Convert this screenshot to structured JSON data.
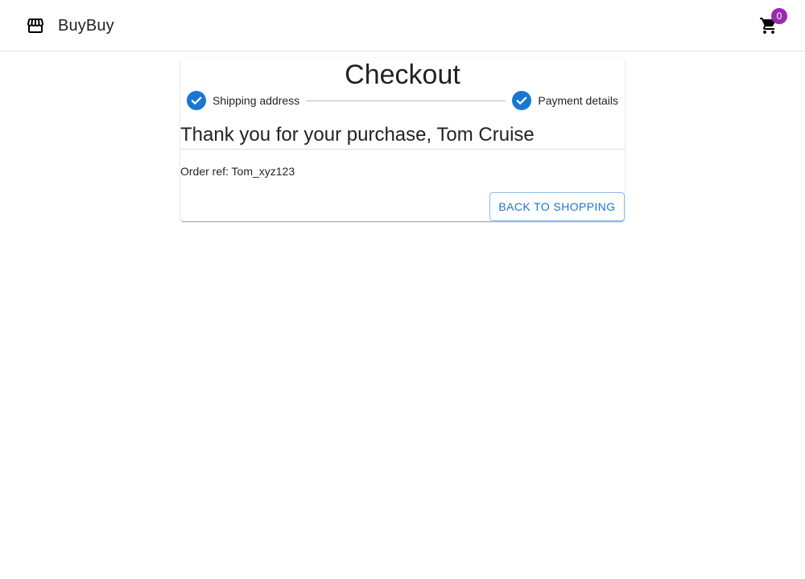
{
  "header": {
    "brand_name": "BuyBuy",
    "brand_icon": "storefront-icon",
    "cart_icon": "shopping-cart-icon",
    "cart_count": "0"
  },
  "checkout": {
    "title": "Checkout",
    "steps": [
      {
        "label": "Shipping address",
        "status": "completed",
        "icon": "check-circle-icon"
      },
      {
        "label": "Payment details",
        "status": "completed",
        "icon": "check-circle-icon"
      }
    ],
    "thank_you": "Thank you for your purchase, Tom Cruise",
    "order_ref": "Order ref: Tom_xyz123",
    "back_button_label": "Back to shopping"
  },
  "colors": {
    "primary": "#1976d2",
    "badge": "#9c27b0",
    "divider": "#e0e0e0"
  }
}
